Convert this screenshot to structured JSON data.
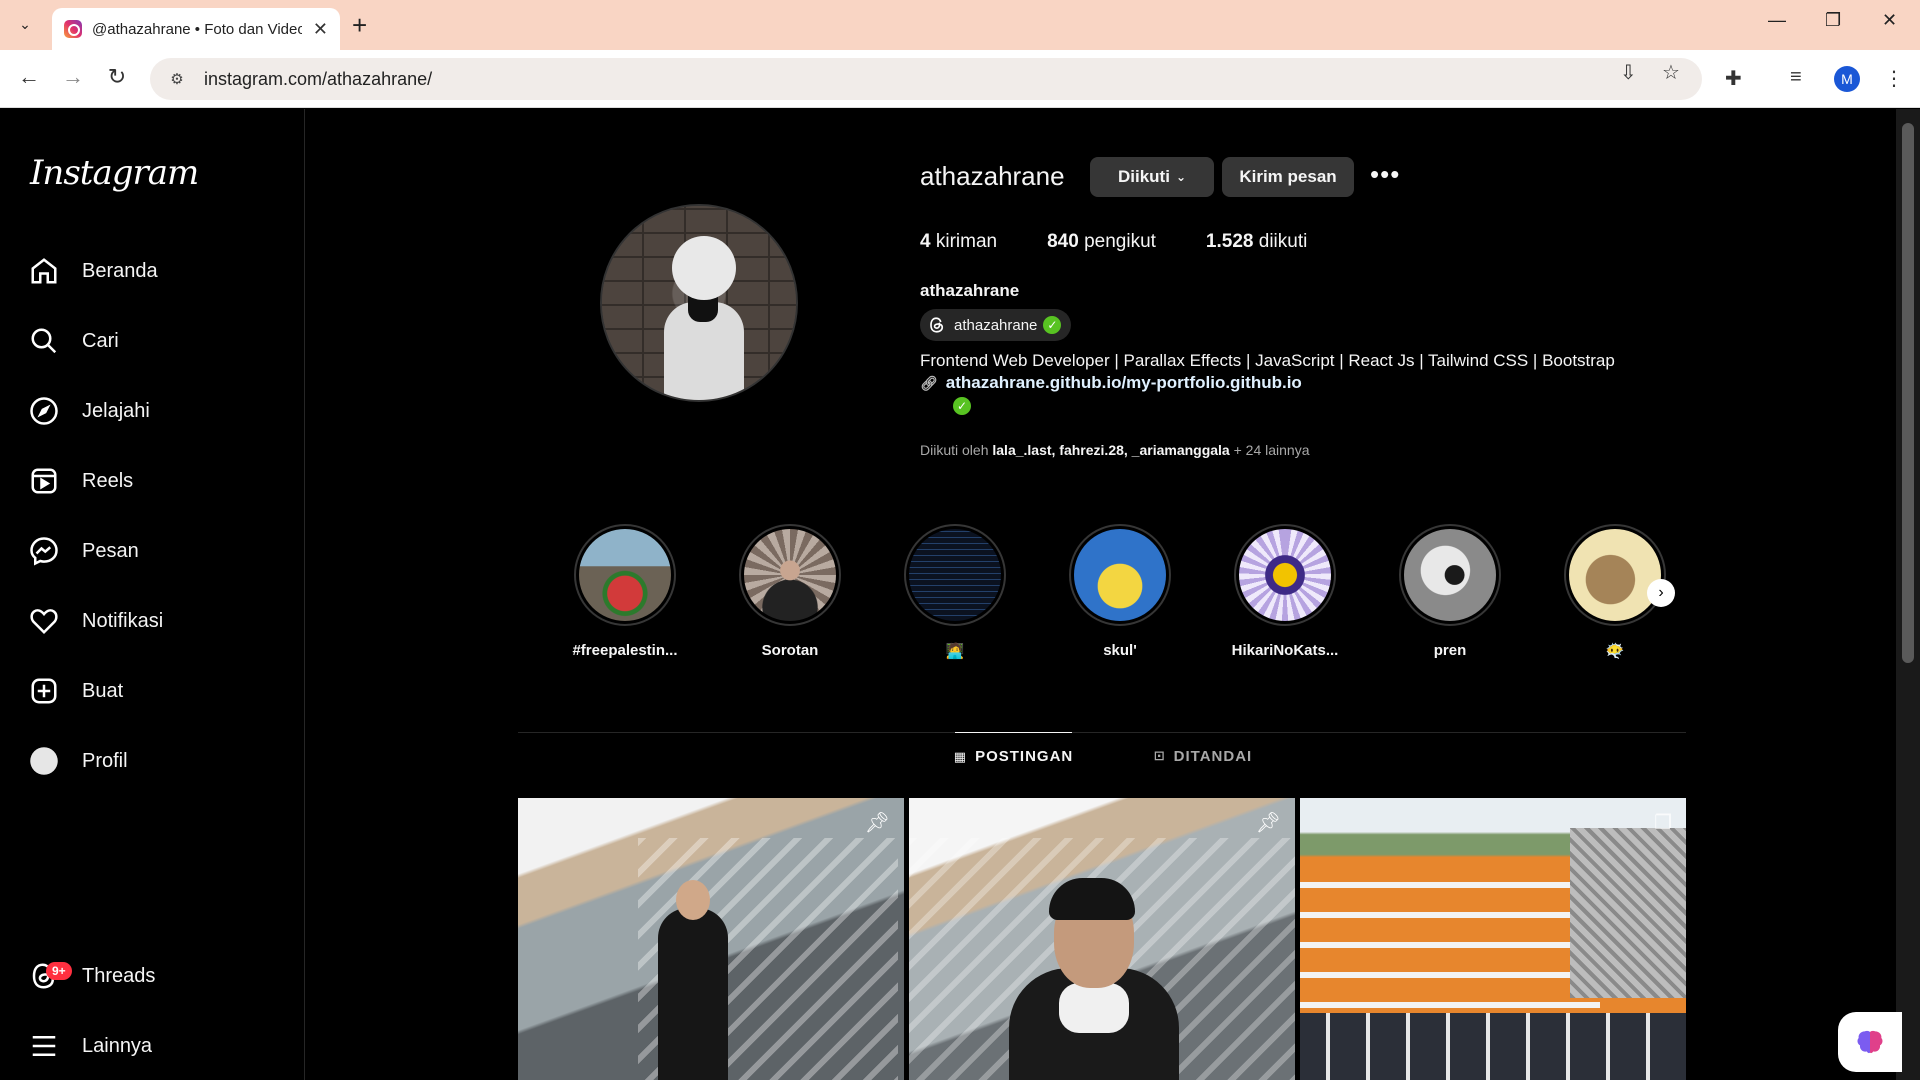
{
  "browser": {
    "tab_title": "@athazahrane • Foto dan Video Instagram",
    "url": "instagram.com/athazahrane/",
    "profile_initial": "M"
  },
  "sidebar": {
    "logo": "Instagram",
    "items": [
      {
        "label": "Beranda",
        "icon": "home-icon"
      },
      {
        "label": "Cari",
        "icon": "search-icon"
      },
      {
        "label": "Jelajahi",
        "icon": "compass-icon"
      },
      {
        "label": "Reels",
        "icon": "reels-icon"
      },
      {
        "label": "Pesan",
        "icon": "messenger-icon"
      },
      {
        "label": "Notifikasi",
        "icon": "heart-icon"
      },
      {
        "label": "Buat",
        "icon": "plus-square-icon"
      },
      {
        "label": "Profil",
        "icon": "avatar-icon"
      }
    ],
    "threads": {
      "label": "Threads",
      "badge": "9+"
    },
    "more": {
      "label": "Lainnya"
    }
  },
  "profile": {
    "username": "athazahrane",
    "follow_btn": "Diikuti",
    "message_btn": "Kirim pesan",
    "posts_count": "4",
    "posts_label": "kiriman",
    "followers_count": "840",
    "followers_label": "pengikut",
    "following_count": "1.528",
    "following_label": "diikuti",
    "full_name": "athazahrane",
    "threads_handle": "athazahrane",
    "bio": "Frontend Web Developer | Parallax Effects | JavaScript | React Js | Tailwind CSS | Bootstrap",
    "link": "athazahrane.github.io/my-portfolio.github.io",
    "followed_by_prefix": "Diikuti oleh",
    "followed_by_names": "lala_.last, fahrezi.28, _ariamanggala",
    "followed_by_suffix": "+ 24 lainnya"
  },
  "highlights": [
    {
      "label": "#freepalestin..."
    },
    {
      "label": "Sorotan"
    },
    {
      "label": "🧑‍💻"
    },
    {
      "label": "skul'"
    },
    {
      "label": "HikariNoKats..."
    },
    {
      "label": "pren"
    },
    {
      "label": "😶‍🌫️"
    }
  ],
  "tabs": {
    "posts": "POSTINGAN",
    "tagged": "DITANDAI"
  }
}
